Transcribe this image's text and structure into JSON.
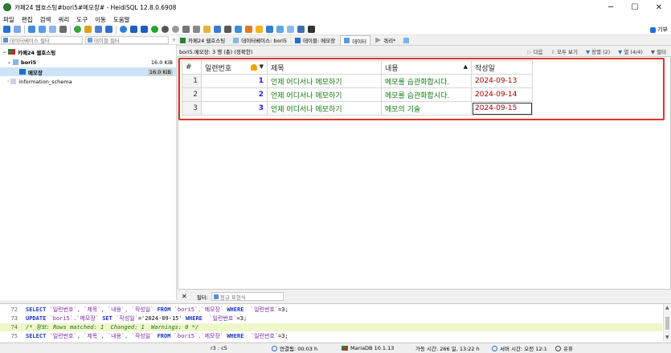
{
  "window": {
    "title": "카페24 웹호스팅#bori5#메모장# - HeidiSQL 12.8.0.6908",
    "controls": [
      "─",
      "☐",
      "✕"
    ]
  },
  "menu": [
    "파일",
    "편집",
    "검색",
    "쿼리",
    "도구",
    "이동",
    "도움말"
  ],
  "toolbar": {
    "donate_label": "기부"
  },
  "left_panel": {
    "db_filter_placeholder": "데이터베이스 필터",
    "table_filter_placeholder": "테이블 필터",
    "tree": [
      {
        "label": "카페24 웹호스팅",
        "size": "",
        "level": 0
      },
      {
        "label": "bori5",
        "size": "16.0 KiB",
        "level": 1
      },
      {
        "label": "메모장",
        "size": "16.0 KiB",
        "level": 2
      },
      {
        "label": "information_schema",
        "size": "",
        "level": 1
      }
    ]
  },
  "tabs": [
    {
      "label": "카페24 웹호스팅"
    },
    {
      "label": "데이터베이스: bori5"
    },
    {
      "label": "테이블: 메모장"
    },
    {
      "label": "데이터"
    },
    {
      "label": "쿼리*"
    }
  ],
  "data_header": {
    "info": "bori5.메모장: 3 행 (총) (정확한)",
    "next": "다음",
    "show_all": "모두 보기",
    "sort": "정렬 (2)",
    "columns": "열 (4/4)",
    "filter": "필터"
  },
  "grid": {
    "columns": [
      "#",
      "일련번호",
      "제목",
      "내용",
      "작성일"
    ],
    "rows": [
      {
        "rownum": "1",
        "id": "1",
        "title": "언제 어디서나 메모하기",
        "content": "메모를 습관화합시다.",
        "date": "2024-09-13"
      },
      {
        "rownum": "2",
        "id": "2",
        "title": "언제 어디서나 메모하기",
        "content": "메모를 습관화합시다.",
        "date": "2024-09-14"
      },
      {
        "rownum": "3",
        "id": "3",
        "title": "언제 어디서나 메모하기",
        "content": "메모의 기술",
        "date": "2024-09-15"
      }
    ],
    "highlight_color": "#e0342c"
  },
  "filter_bar": {
    "close": "✕",
    "label": "필터:",
    "regex": "정규 표현식"
  },
  "sql_log": [
    {
      "num": "72",
      "parts": [
        [
          "kw",
          "SELECT "
        ],
        [
          "str",
          "`일련번호`, `제목`, `내용`, `작성일`"
        ],
        [
          "kw",
          " FROM "
        ],
        [
          "str",
          "`bori5`.`메모장`"
        ],
        [
          "kw",
          " WHERE "
        ],
        [
          "str",
          " `일련번호`"
        ],
        [
          "",
          "=3;"
        ]
      ]
    },
    {
      "num": "73",
      "parts": [
        [
          "kw",
          "UPDATE "
        ],
        [
          "str",
          "`bori5`.`메모장`"
        ],
        [
          "kw",
          " SET "
        ],
        [
          "str",
          "`작성일`"
        ],
        [
          "",
          "='2024-09-15'"
        ],
        [
          "kw",
          " WHERE "
        ],
        [
          "str",
          " `일련번호`"
        ],
        [
          "",
          "=3;"
        ]
      ]
    },
    {
      "num": "74",
      "parts": [
        [
          "cm",
          "/* 정보: Rows matched: 1  Changed: 1  Warnings: 0 */"
        ]
      ],
      "highlight": true
    },
    {
      "num": "75",
      "parts": [
        [
          "kw",
          "SELECT "
        ],
        [
          "str",
          "`일련번호`, `제목`, `내용`, `작성일`"
        ],
        [
          "kw",
          " FROM "
        ],
        [
          "str",
          "`bori5`.`메모장`"
        ],
        [
          "kw",
          " WHERE "
        ],
        [
          "str",
          " `일련번호`"
        ],
        [
          "",
          "=3;"
        ]
      ]
    }
  ],
  "status": {
    "pos": "r3 : c5",
    "connected": "연결됨: 00:03 h",
    "server": "MariaDB 10.1.13",
    "uptime": "가동 시간: 266 일, 13:22 h",
    "server_time": "서버 시간: 오전 12:1",
    "idle": "유휴"
  }
}
